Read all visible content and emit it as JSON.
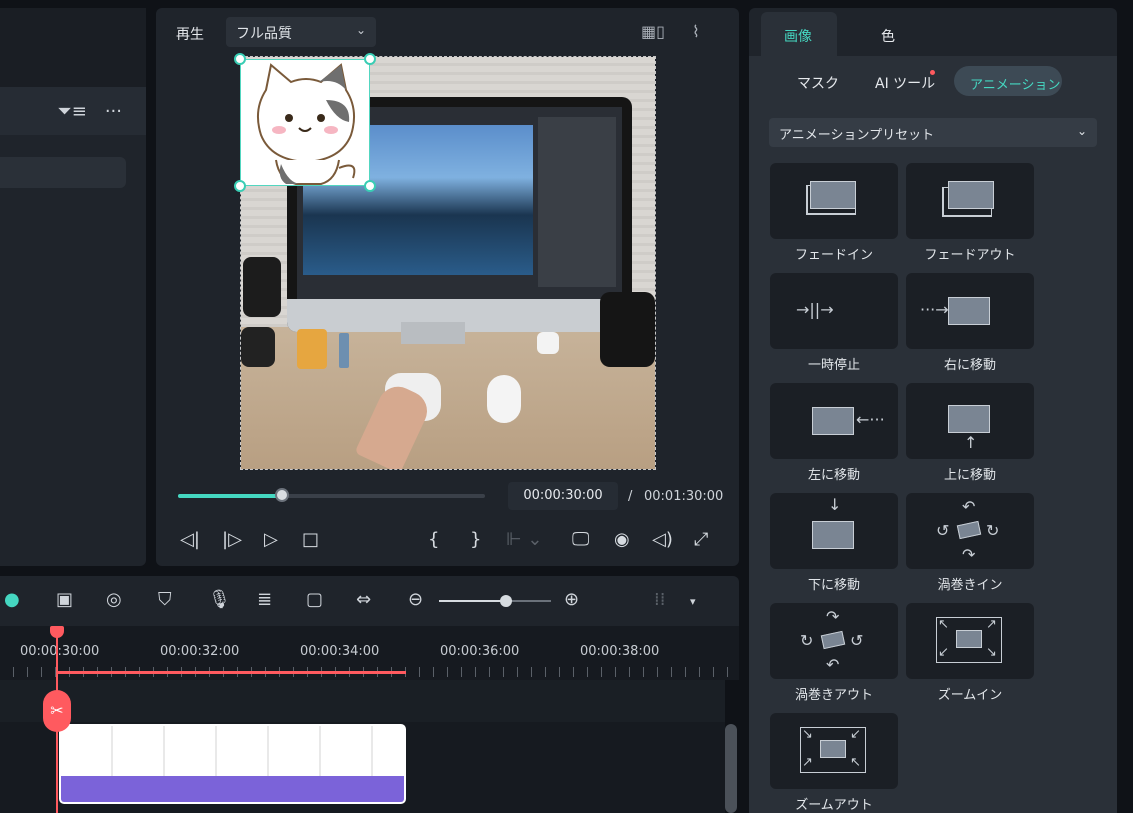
{
  "player": {
    "play_label": "再生",
    "quality_value": "フル品質",
    "current_time": "00:00:30:00",
    "separator": "/",
    "total_time": "00:01:30:00",
    "progress_fraction": 0.34
  },
  "timeline": {
    "ruler_labels": [
      "00:00:30:00",
      "00:00:32:00",
      "00:00:34:00",
      "00:00:36:00",
      "00:00:38:00"
    ],
    "zoom_fraction": 0.6
  },
  "right_panel": {
    "tabs": [
      "画像",
      "色"
    ],
    "subtabs": [
      "マスク",
      "AI ツール",
      "アニメーション"
    ],
    "preset_dropdown": "アニメーションプリセット",
    "presets": [
      {
        "label": "フェードイン",
        "icon": "fade-in-icon"
      },
      {
        "label": "フェードアウト",
        "icon": "fade-out-icon"
      },
      {
        "label": "一時停止",
        "icon": "pause-icon"
      },
      {
        "label": "右に移動",
        "icon": "move-right-icon"
      },
      {
        "label": "左に移動",
        "icon": "move-left-icon"
      },
      {
        "label": "上に移動",
        "icon": "move-up-icon"
      },
      {
        "label": "下に移動",
        "icon": "move-down-icon"
      },
      {
        "label": "渦巻きイン",
        "icon": "swirl-in-icon"
      },
      {
        "label": "渦巻きアウト",
        "icon": "swirl-out-icon"
      },
      {
        "label": "ズームイン",
        "icon": "zoom-in-icon"
      },
      {
        "label": "ズームアウト",
        "icon": "zoom-out-icon"
      }
    ]
  },
  "glyphs": {
    "dots": "···",
    "chev": "⌄",
    "brace_open": "{",
    "brace_close": "}",
    "scissors": "✂",
    "pause": "→||→",
    "right": "···→",
    "left": "←···",
    "up": "↑",
    "down": "↓"
  },
  "colors": {
    "accent": "#45d7c1",
    "playhead": "#ff5a5f",
    "clip_bar": "#7b63d9"
  }
}
